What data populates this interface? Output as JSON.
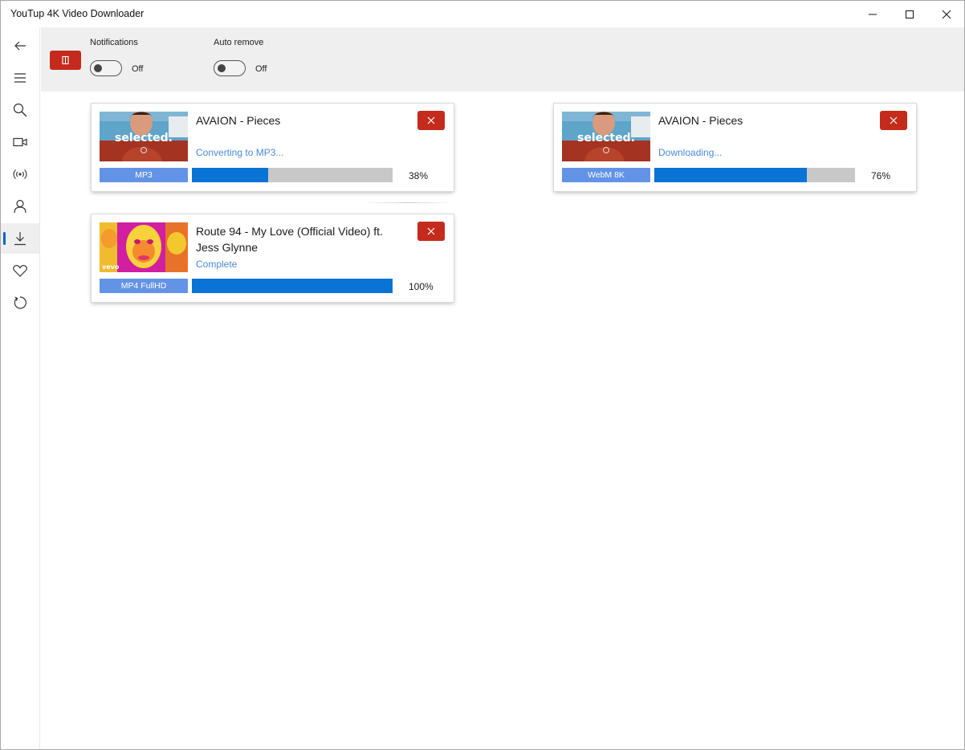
{
  "window": {
    "title": "YouTup 4K Video Downloader",
    "controls": [
      "minimize",
      "maximize",
      "close"
    ]
  },
  "nav": {
    "items": [
      {
        "name": "back",
        "icon": "back-arrow-icon"
      },
      {
        "name": "menu",
        "icon": "hamburger-icon"
      },
      {
        "name": "search",
        "icon": "search-icon"
      },
      {
        "name": "video",
        "icon": "video-camera-icon"
      },
      {
        "name": "live",
        "icon": "broadcast-icon"
      },
      {
        "name": "account",
        "icon": "person-icon"
      },
      {
        "name": "downloads",
        "icon": "download-icon",
        "active": true
      },
      {
        "name": "favorites",
        "icon": "heart-icon"
      },
      {
        "name": "history",
        "icon": "refresh-icon"
      }
    ]
  },
  "toolbar": {
    "clear_icon": "clear-all-icon",
    "notifications": {
      "label": "Notifications",
      "state": "Off"
    },
    "auto_remove": {
      "label": "Auto remove",
      "state": "Off"
    }
  },
  "downloads": [
    {
      "title": "AVAION - Pieces",
      "status": "Converting to MP3...",
      "format": "MP3",
      "progress": 38,
      "progress_text": "38%",
      "thumb_text": "selected."
    },
    {
      "title": "AVAION - Pieces",
      "status": "Downloading...",
      "format": "WebM 8K",
      "progress": 76,
      "progress_text": "76%",
      "thumb_text": "selected."
    },
    {
      "title": "Route 94 - My Love (Official Video) ft. Jess Glynne",
      "status": "Complete",
      "format": "MP4 FullHD",
      "progress": 100,
      "progress_text": "100%",
      "thumb_text": "vevo"
    }
  ],
  "colors": {
    "accent": "#0a73d6",
    "danger": "#c42b1c",
    "badge": "#6393e6",
    "status": "#4a8ad8",
    "toolbar_bg": "#efefef"
  }
}
